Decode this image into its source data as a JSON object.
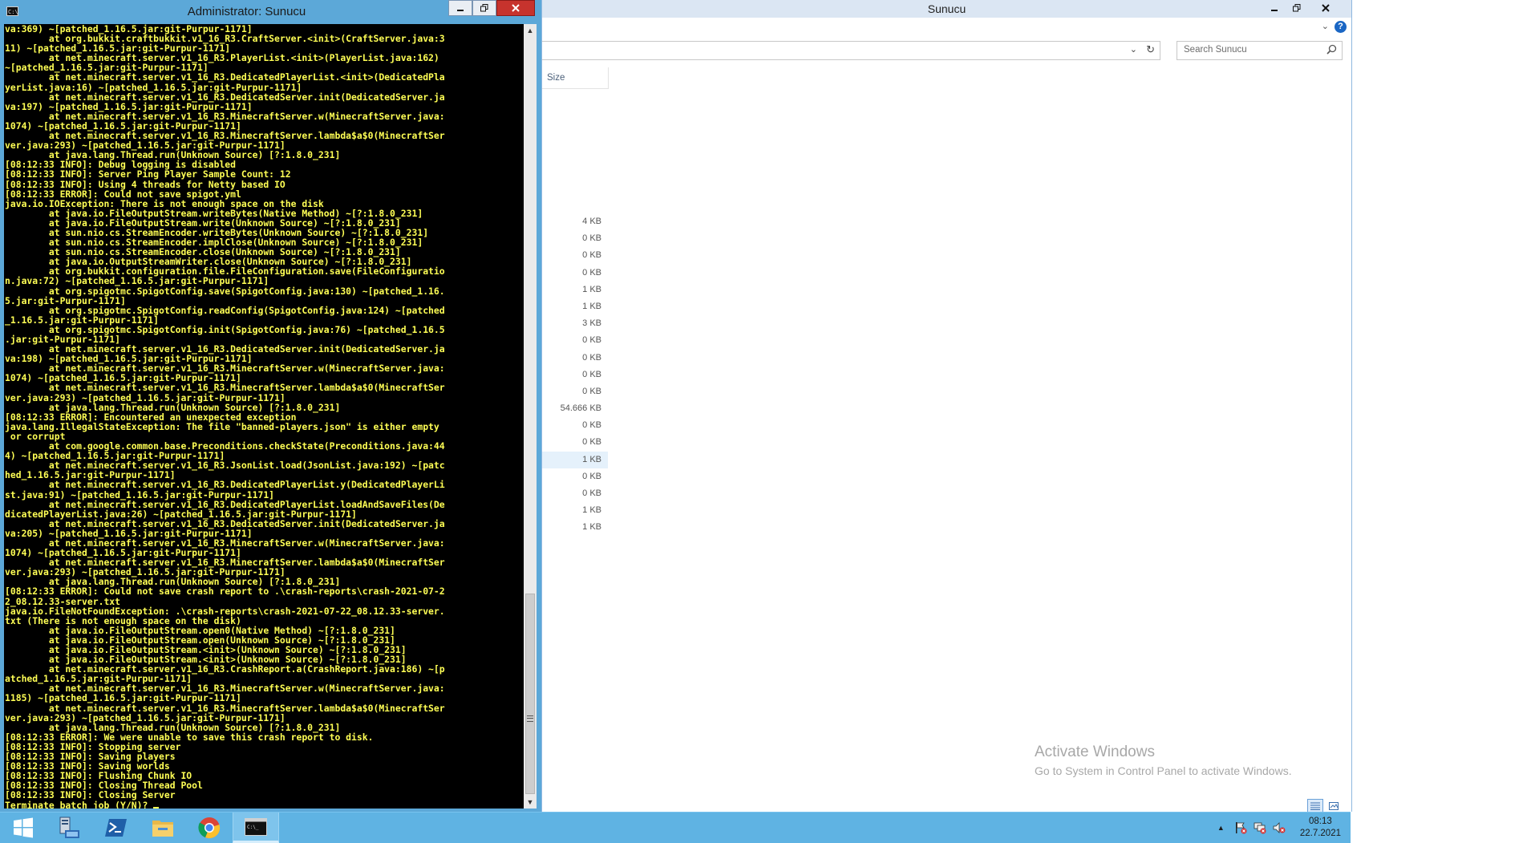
{
  "explorer": {
    "title": "Sunucu",
    "search_placeholder": "Search Sunucu",
    "size_column_header": "Size",
    "sizes": [
      "4 KB",
      "0 KB",
      "0 KB",
      "0 KB",
      "1 KB",
      "1 KB",
      "3 KB",
      "0 KB",
      "0 KB",
      "0 KB",
      "0 KB",
      "54.666 KB",
      "0 KB",
      "0 KB",
      "1 KB",
      "0 KB",
      "0 KB",
      "1 KB",
      "1 KB"
    ],
    "selected_index": 14,
    "activation": {
      "line1": "Activate Windows",
      "line2": "Go to System in Control Panel to activate Windows."
    }
  },
  "console": {
    "title": "Administrator: Sunucu",
    "output": "va:369) ~[patched_1.16.5.jar:git-Purpur-1171]\n        at org.bukkit.craftbukkit.v1_16_R3.CraftServer.<init>(CraftServer.java:3\n11) ~[patched_1.16.5.jar:git-Purpur-1171]\n        at net.minecraft.server.v1_16_R3.PlayerList.<init>(PlayerList.java:162)\n~[patched_1.16.5.jar:git-Purpur-1171]\n        at net.minecraft.server.v1_16_R3.DedicatedPlayerList.<init>(DedicatedPla\nyerList.java:16) ~[patched_1.16.5.jar:git-Purpur-1171]\n        at net.minecraft.server.v1_16_R3.DedicatedServer.init(DedicatedServer.ja\nva:197) ~[patched_1.16.5.jar:git-Purpur-1171]\n        at net.minecraft.server.v1_16_R3.MinecraftServer.w(MinecraftServer.java:\n1074) ~[patched_1.16.5.jar:git-Purpur-1171]\n        at net.minecraft.server.v1_16_R3.MinecraftServer.lambda$a$0(MinecraftSer\nver.java:293) ~[patched_1.16.5.jar:git-Purpur-1171]\n        at java.lang.Thread.run(Unknown Source) [?:1.8.0_231]\n[08:12:33 INFO]: Debug logging is disabled\n[08:12:33 INFO]: Server Ping Player Sample Count: 12\n[08:12:33 INFO]: Using 4 threads for Netty based IO\n[08:12:33 ERROR]: Could not save spigot.yml\njava.io.IOException: There is not enough space on the disk\n        at java.io.FileOutputStream.writeBytes(Native Method) ~[?:1.8.0_231]\n        at java.io.FileOutputStream.write(Unknown Source) ~[?:1.8.0_231]\n        at sun.nio.cs.StreamEncoder.writeBytes(Unknown Source) ~[?:1.8.0_231]\n        at sun.nio.cs.StreamEncoder.implClose(Unknown Source) ~[?:1.8.0_231]\n        at sun.nio.cs.StreamEncoder.close(Unknown Source) ~[?:1.8.0_231]\n        at java.io.OutputStreamWriter.close(Unknown Source) ~[?:1.8.0_231]\n        at org.bukkit.configuration.file.FileConfiguration.save(FileConfiguratio\nn.java:72) ~[patched_1.16.5.jar:git-Purpur-1171]\n        at org.spigotmc.SpigotConfig.save(SpigotConfig.java:130) ~[patched_1.16.\n5.jar:git-Purpur-1171]\n        at org.spigotmc.SpigotConfig.readConfig(SpigotConfig.java:124) ~[patched\n_1.16.5.jar:git-Purpur-1171]\n        at org.spigotmc.SpigotConfig.init(SpigotConfig.java:76) ~[patched_1.16.5\n.jar:git-Purpur-1171]\n        at net.minecraft.server.v1_16_R3.DedicatedServer.init(DedicatedServer.ja\nva:198) ~[patched_1.16.5.jar:git-Purpur-1171]\n        at net.minecraft.server.v1_16_R3.MinecraftServer.w(MinecraftServer.java:\n1074) ~[patched_1.16.5.jar:git-Purpur-1171]\n        at net.minecraft.server.v1_16_R3.MinecraftServer.lambda$a$0(MinecraftSer\nver.java:293) ~[patched_1.16.5.jar:git-Purpur-1171]\n        at java.lang.Thread.run(Unknown Source) [?:1.8.0_231]\n[08:12:33 ERROR]: Encountered an unexpected exception\njava.lang.IllegalStateException: The file \"banned-players.json\" is either empty\n or corrupt\n        at com.google.common.base.Preconditions.checkState(Preconditions.java:44\n4) ~[patched_1.16.5.jar:git-Purpur-1171]\n        at net.minecraft.server.v1_16_R3.JsonList.load(JsonList.java:192) ~[patc\nhed_1.16.5.jar:git-Purpur-1171]\n        at net.minecraft.server.v1_16_R3.DedicatedPlayerList.y(DedicatedPlayerLi\nst.java:91) ~[patched_1.16.5.jar:git-Purpur-1171]\n        at net.minecraft.server.v1_16_R3.DedicatedPlayerList.loadAndSaveFiles(De\ndicatedPlayerList.java:26) ~[patched_1.16.5.jar:git-Purpur-1171]\n        at net.minecraft.server.v1_16_R3.DedicatedServer.init(DedicatedServer.ja\nva:205) ~[patched_1.16.5.jar:git-Purpur-1171]\n        at net.minecraft.server.v1_16_R3.MinecraftServer.w(MinecraftServer.java:\n1074) ~[patched_1.16.5.jar:git-Purpur-1171]\n        at net.minecraft.server.v1_16_R3.MinecraftServer.lambda$a$0(MinecraftSer\nver.java:293) ~[patched_1.16.5.jar:git-Purpur-1171]\n        at java.lang.Thread.run(Unknown Source) [?:1.8.0_231]\n[08:12:33 ERROR]: Could not save crash report to .\\crash-reports\\crash-2021-07-2\n2_08.12.33-server.txt\njava.io.FileNotFoundException: .\\crash-reports\\crash-2021-07-22_08.12.33-server.\ntxt (There is not enough space on the disk)\n        at java.io.FileOutputStream.open0(Native Method) ~[?:1.8.0_231]\n        at java.io.FileOutputStream.open(Unknown Source) ~[?:1.8.0_231]\n        at java.io.FileOutputStream.<init>(Unknown Source) ~[?:1.8.0_231]\n        at java.io.FileOutputStream.<init>(Unknown Source) ~[?:1.8.0_231]\n        at net.minecraft.server.v1_16_R3.CrashReport.a(CrashReport.java:186) ~[p\natched_1.16.5.jar:git-Purpur-1171]\n        at net.minecraft.server.v1_16_R3.MinecraftServer.w(MinecraftServer.java:\n1185) ~[patched_1.16.5.jar:git-Purpur-1171]\n        at net.minecraft.server.v1_16_R3.MinecraftServer.lambda$a$0(MinecraftSer\nver.java:293) ~[patched_1.16.5.jar:git-Purpur-1171]\n        at java.lang.Thread.run(Unknown Source) [?:1.8.0_231]\n[08:12:33 ERROR]: We were unable to save this crash report to disk.\n[08:12:33 INFO]: Stopping server\n[08:12:33 INFO]: Saving players\n[08:12:33 INFO]: Saving worlds\n[08:12:33 INFO]: Flushing Chunk IO\n[08:12:33 INFO]: Closing Thread Pool\n[08:12:33 INFO]: Closing Server\nTerminate batch job (Y/N)? ",
    "text_color": "#ffff55",
    "background": "#000000"
  },
  "taskbar": {
    "time": "08:13",
    "date": "22.7.2021",
    "apps": [
      "start-icon",
      "server-manager-icon",
      "powershell-icon",
      "file-explorer-icon",
      "chrome-icon",
      "cmd-icon"
    ],
    "active_app": "cmd-icon"
  },
  "colors": {
    "taskbar": "#5fb3e3",
    "console_frame": "#5ca8d8",
    "close_button": "#c7332d"
  }
}
